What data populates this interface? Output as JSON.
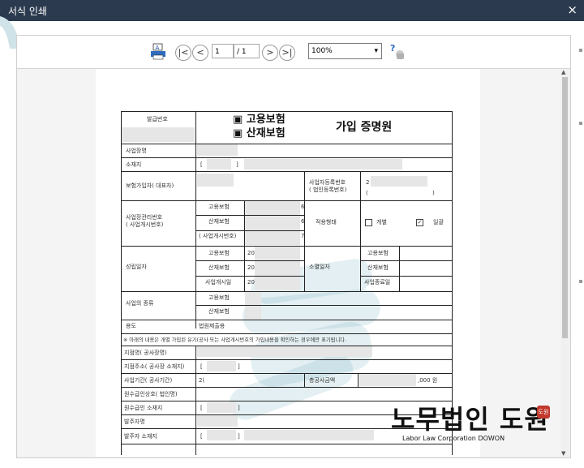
{
  "window": {
    "title": "서식 인쇄",
    "close_label": "×"
  },
  "toolbar": {
    "print_icon": "printer-icon",
    "first_label": "|<",
    "prev_label": "<",
    "page_current": "1",
    "page_total": "/ 1",
    "next_label": ">",
    "last_label": ">|",
    "zoom_value": "100%",
    "zoom_arrow": "▾",
    "help_label": "?"
  },
  "form": {
    "issue_no_label": "발급번호",
    "check_employment": "▣ 고용보험",
    "check_accident": "▣ 산재보험",
    "doc_title": "가입 증명원",
    "workplace_name_label": "사업장명",
    "address_label": "소재지",
    "address_bracket_open": "[",
    "address_bracket_close": "]",
    "insured_label": "보험가입자( 대표자)",
    "bizno_label_1": "사업자등록번호",
    "bizno_label_2": "( 법인등록번호)",
    "bizno_value": "2",
    "bizno_paren_open": "(",
    "bizno_paren_close": ")",
    "mgmt_label_1": "사업장관리번호",
    "mgmt_label_2": "( 사업개시번호)",
    "mgmt_employment": "고용보험",
    "mgmt_accident": "산재보험",
    "mgmt_start": "( 사업개시번호)",
    "mgmt_val_1": "6",
    "mgmt_val_2": "6",
    "mgmt_val_3": "7",
    "apply_type_label": "적용형태",
    "apply_individual": "개별",
    "apply_bulk": "일괄",
    "established_label": "성립일자",
    "est_employment": "고용보험",
    "est_accident": "산재보험",
    "est_start": "사업개시일",
    "est_val_1": "20",
    "est_val_2": "20",
    "est_val_3": "20",
    "closed_label": "소멸일자",
    "closed_employment": "고용보험",
    "closed_accident": "산재보험",
    "closed_end": "사업종료일",
    "biz_type_label": "사업의 종류",
    "type_employment": "고용보험",
    "type_accident": "산재보험",
    "purpose_label": "용도",
    "purpose_value": "법원제출용",
    "note": "※ 아래의 내용은 개별 가입된 유기(공사 또는 사업개시번호의 가입내용을 확인하는 경우에만 표기됩니다.",
    "branch_name_label": "지점명( 공사장명)",
    "branch_addr_label": "지점주소( 공사장 소재지)",
    "branch_addr_open": "[",
    "branch_addr_close": "]",
    "period_label": "사업기간( 공사기간)",
    "period_value": "2(",
    "total_amount_label": "총공사금액",
    "total_amount_value": ",000 원",
    "prime_contractor_label": "원수급인상호( 법인명)",
    "prime_addr_label": "원수급인 소재지",
    "prime_addr_open": "[",
    "prime_addr_close": "]",
    "client_label": "발주자명",
    "client_addr_label": "발주자 소재지",
    "client_addr_open": "[",
    "client_addr_close": "]"
  },
  "watermark": {
    "brand": "노무법인 도원",
    "sub": "Labor Law Corporation DOWON",
    "seal": "도원"
  }
}
